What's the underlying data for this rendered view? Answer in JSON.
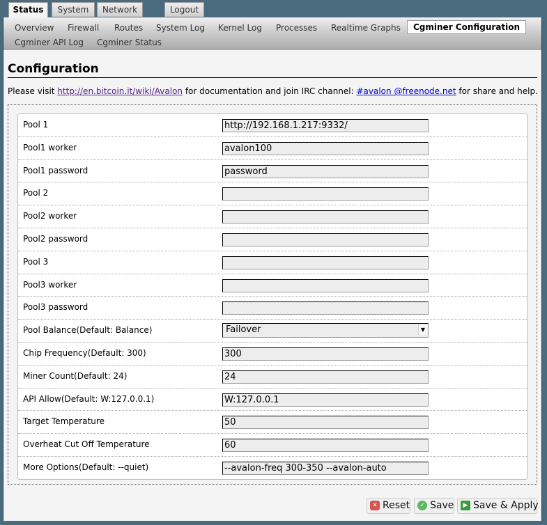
{
  "top_tabs": [
    {
      "label": "Status",
      "active": true
    },
    {
      "label": "System",
      "active": false
    },
    {
      "label": "Network",
      "active": false
    },
    {
      "label": "Logout",
      "active": false
    }
  ],
  "sub_tabs": [
    {
      "label": "Overview"
    },
    {
      "label": "Firewall"
    },
    {
      "label": "Routes"
    },
    {
      "label": "System Log"
    },
    {
      "label": "Kernel Log"
    },
    {
      "label": "Processes"
    },
    {
      "label": "Realtime Graphs"
    },
    {
      "label": "Cgminer Configuration",
      "active": true
    },
    {
      "label": "Cgminer API Log"
    },
    {
      "label": "Cgminer Status"
    }
  ],
  "page_title": "Configuration",
  "intro": {
    "prefix": "Please visit ",
    "link1": "http://en.bitcoin.it/wiki/Avalon",
    "middle": " for documentation and join IRC channel: ",
    "link2": "#avalon @freenode.net",
    "suffix": " for share and help."
  },
  "fields": [
    {
      "label": "Pool 1",
      "value": "http://192.168.1.217:9332/"
    },
    {
      "label": "Pool1 worker",
      "value": "avalon100"
    },
    {
      "label": "Pool1 password",
      "value": "password"
    },
    {
      "label": "Pool 2",
      "value": ""
    },
    {
      "label": "Pool2 worker",
      "value": ""
    },
    {
      "label": "Pool2 password",
      "value": ""
    },
    {
      "label": "Pool 3",
      "value": ""
    },
    {
      "label": "Pool3 worker",
      "value": ""
    },
    {
      "label": "Pool3 password",
      "value": ""
    },
    {
      "label": "Pool Balance(Default: Balance)",
      "value": "Failover",
      "type": "select"
    },
    {
      "label": "Chip Frequency(Default: 300)",
      "value": "300"
    },
    {
      "label": "Miner Count(Default: 24)",
      "value": "24"
    },
    {
      "label": "API Allow(Default: W:127.0.0.1)",
      "value": "W:127.0.0.1"
    },
    {
      "label": "Target Temperature",
      "value": "50"
    },
    {
      "label": "Overheat Cut Off Temperature",
      "value": "60"
    },
    {
      "label": "More Options(Default: --quiet)",
      "value": "--avalon-freq 300-350 --avalon-auto"
    }
  ],
  "buttons": {
    "reset": "Reset",
    "save": "Save",
    "save_apply": "Save & Apply"
  },
  "icons": {
    "reset": "reset-x-icon",
    "save": "save-check-icon",
    "apply": "apply-play-icon",
    "dropdown": "chevron-down-icon"
  },
  "colors": {
    "background": "#4a6a7e",
    "page": "#f4f4f4",
    "link": "#0000cc",
    "visited_link": "#551a8b",
    "reset_icon": "#d9534f",
    "save_icon": "#5cb85c",
    "apply_icon": "#3c9a3c"
  }
}
